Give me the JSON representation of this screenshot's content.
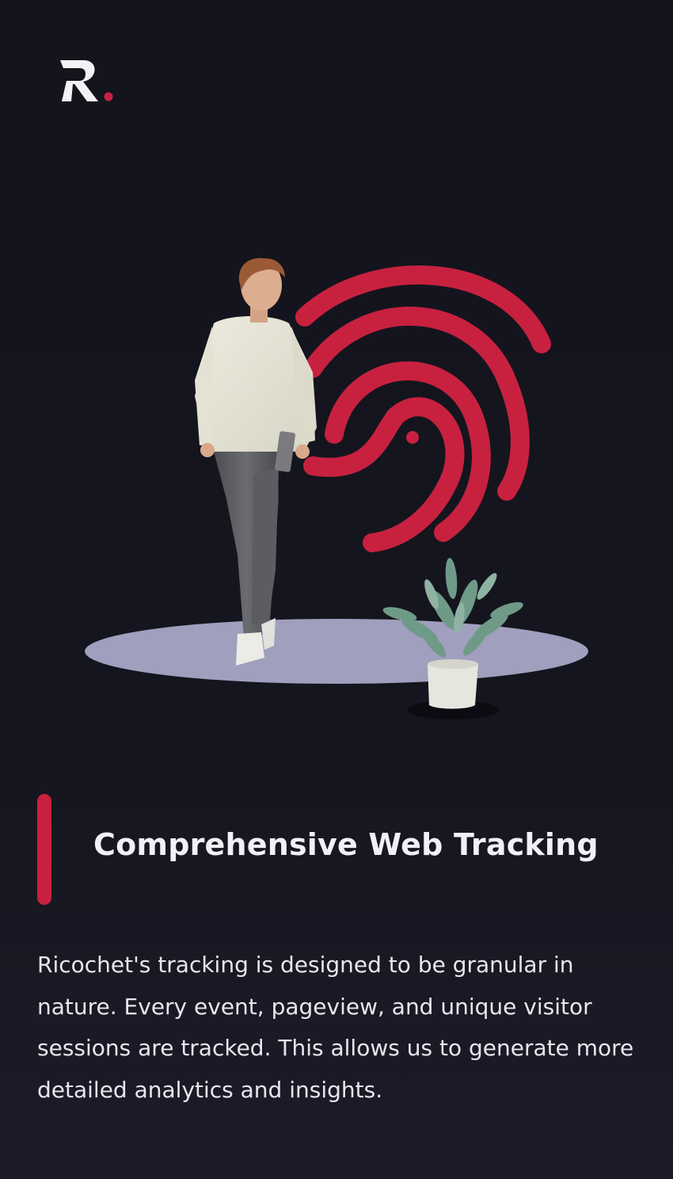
{
  "brand": {
    "logo_letter": "R",
    "accent_color": "#c8213f"
  },
  "hero": {
    "illustration_icons": [
      "fingerprint-icon",
      "person-walking-photo",
      "potted-plant-photo"
    ]
  },
  "feature": {
    "title": "Comprehensive Web Tracking",
    "description": "Ricochet's tracking is designed to be granular in nature. Every event, pageview, and unique visitor sessions are tracked. This allows us to generate more detailed analytics and insights."
  },
  "colors": {
    "background": "#15151f",
    "platform": "#a09fbd",
    "text": "#f1f0f6"
  }
}
